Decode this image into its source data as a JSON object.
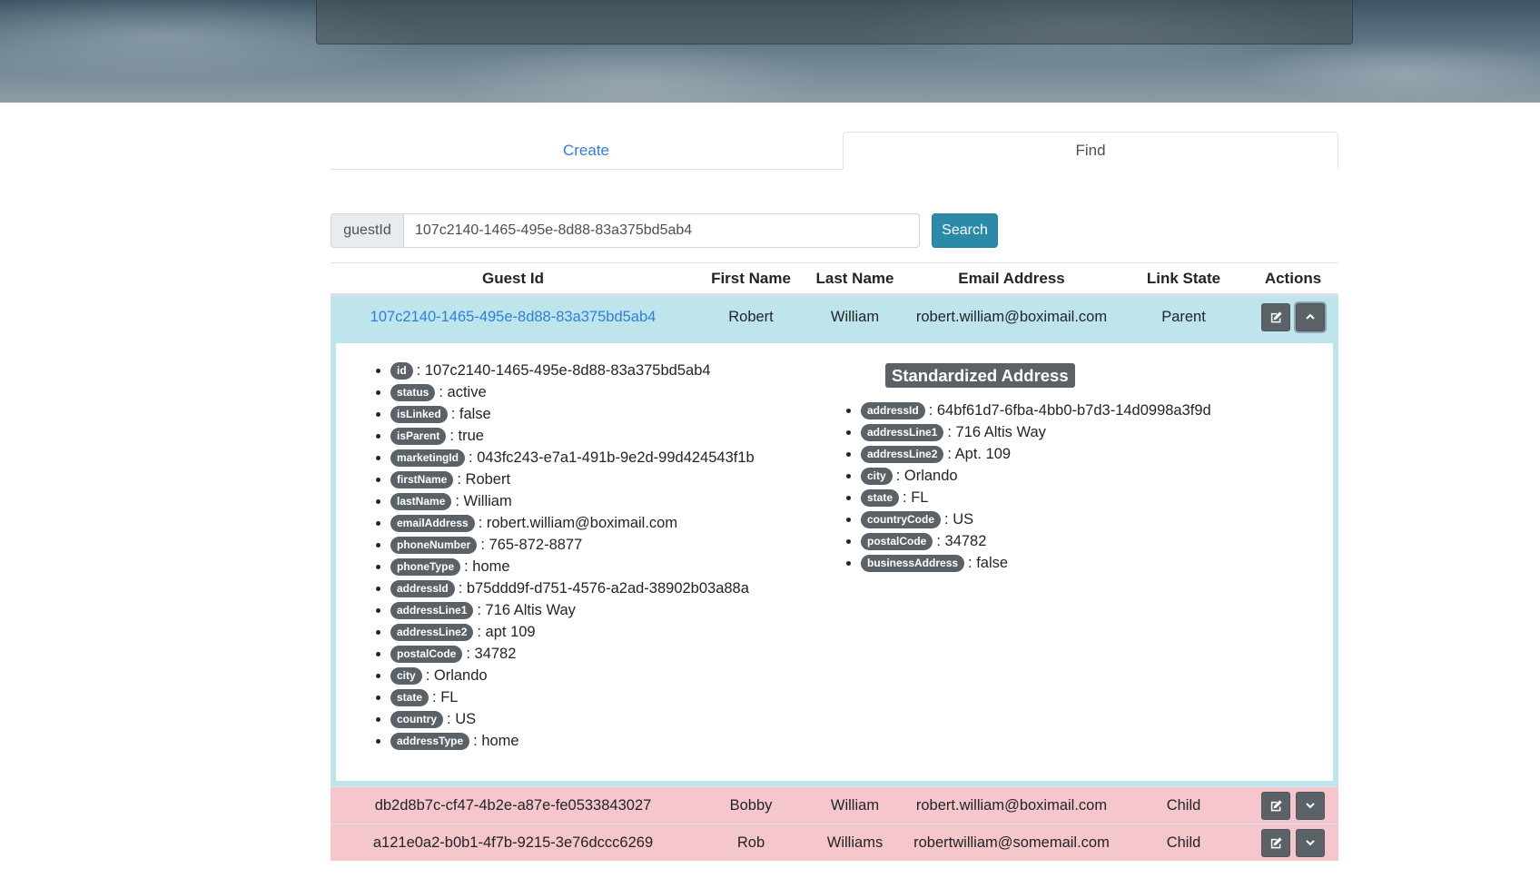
{
  "tabs": {
    "create": "Create",
    "find": "Find"
  },
  "search": {
    "prefix": "guestId",
    "value": "107c2140-1465-495e-8d88-83a375bd5ab4",
    "button": "Search"
  },
  "table": {
    "headers": [
      "Guest Id",
      "First Name",
      "Last Name",
      "Email Address",
      "Link State",
      "Actions"
    ],
    "parent": {
      "guest_id": "107c2140-1465-495e-8d88-83a375bd5ab4",
      "first_name": "Robert",
      "last_name": "William",
      "email": "robert.william@boximail.com",
      "link_state": "Parent"
    },
    "children": [
      {
        "guest_id": "db2d8b7c-cf47-4b2e-a87e-fe0533843027",
        "first_name": "Bobby",
        "last_name": "William",
        "email": "robert.william@boximail.com",
        "link_state": "Child"
      },
      {
        "guest_id": "a121e0a2-b0b1-4f7b-9215-3e76dccc6269",
        "first_name": "Rob",
        "last_name": "Williams",
        "email": "robertwilliam@somemail.com",
        "link_state": "Child"
      }
    ]
  },
  "details": [
    {
      "key": "id",
      "value": "107c2140-1465-495e-8d88-83a375bd5ab4"
    },
    {
      "key": "status",
      "value": "active"
    },
    {
      "key": "isLinked",
      "value": "false"
    },
    {
      "key": "isParent",
      "value": "true"
    },
    {
      "key": "marketingId",
      "value": "043fc243-e7a1-491b-9e2d-99d424543f1b"
    },
    {
      "key": "firstName",
      "value": "Robert"
    },
    {
      "key": "lastName",
      "value": "William"
    },
    {
      "key": "emailAddress",
      "value": "robert.william@boximail.com"
    },
    {
      "key": "phoneNumber",
      "value": "765-872-8877"
    },
    {
      "key": "phoneType",
      "value": "home"
    },
    {
      "key": "addressId",
      "value": "b75ddd9f-d751-4576-a2ad-38902b03a88a"
    },
    {
      "key": "addressLine1",
      "value": "716 Altis Way"
    },
    {
      "key": "addressLine2",
      "value": "apt 109"
    },
    {
      "key": "postalCode",
      "value": "34782"
    },
    {
      "key": "city",
      "value": "Orlando"
    },
    {
      "key": "state",
      "value": "FL"
    },
    {
      "key": "country",
      "value": "US"
    },
    {
      "key": "addressType",
      "value": "home"
    }
  ],
  "standardized": {
    "title": "Standardized Address",
    "items": [
      {
        "key": "addressId",
        "value": "64bf61d7-6fba-4bb0-b7d3-14d0998a3f9d"
      },
      {
        "key": "addressLine1",
        "value": "716 Altis Way"
      },
      {
        "key": "addressLine2",
        "value": "Apt. 109"
      },
      {
        "key": "city",
        "value": "Orlando"
      },
      {
        "key": "state",
        "value": "FL"
      },
      {
        "key": "countryCode",
        "value": "US"
      },
      {
        "key": "postalCode",
        "value": "34782"
      },
      {
        "key": "businessAddress",
        "value": "false"
      }
    ]
  },
  "icons": {
    "edit": "edit-icon",
    "expand": "chevron-down-icon",
    "collapse": "chevron-up-icon"
  }
}
